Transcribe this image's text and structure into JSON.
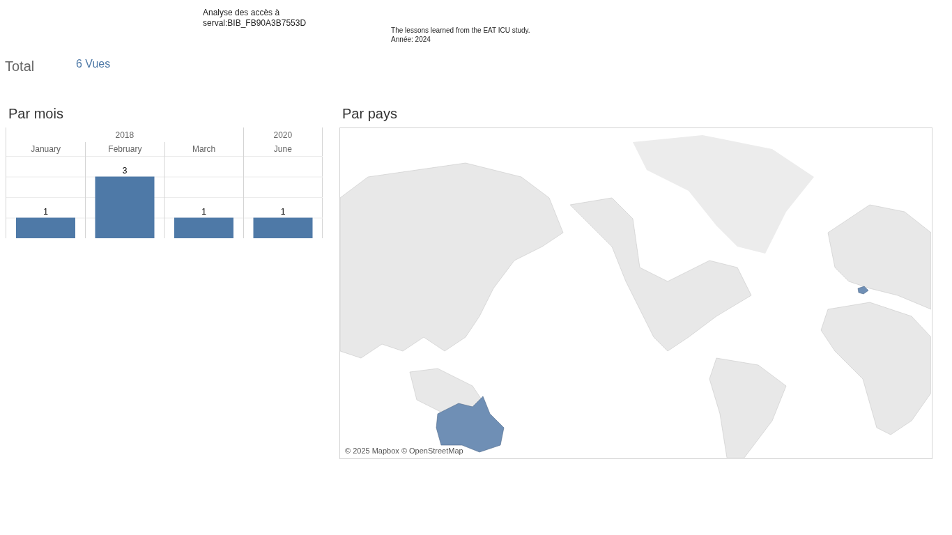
{
  "header": {
    "title_lines": [
      "Analyse des accès à",
      "serval:BIB_FB90A3B7553D"
    ],
    "publication_lines": [
      "The lessons learned from the EAT ICU study.",
      "Année: 2024"
    ]
  },
  "total": {
    "label": "Total",
    "value": "6 Vues"
  },
  "monthly": {
    "title": "Par mois",
    "years": [
      "2018",
      "2020"
    ],
    "chart_data": {
      "type": "bar",
      "categories": [
        "January",
        "February",
        "March",
        "June"
      ],
      "values": [
        1,
        3,
        1,
        1
      ],
      "ylim": [
        0,
        4
      ],
      "data_labels": true
    }
  },
  "map": {
    "title": "Par pays",
    "attribution": "© 2025 Mapbox © OpenStreetMap"
  }
}
